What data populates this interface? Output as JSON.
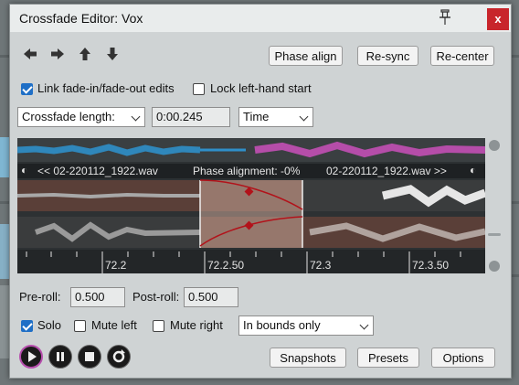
{
  "window": {
    "title": "Crossfade Editor: Vox",
    "close_label": "x"
  },
  "toolbar": {
    "phase_align": "Phase align",
    "resync": "Re-sync",
    "recenter": "Re-center",
    "arrow_icons": [
      "arrow-left-icon",
      "arrow-right-icon",
      "arrow-up-icon",
      "arrow-down-icon"
    ]
  },
  "options": {
    "link_edits": {
      "label": "Link fade-in/fade-out edits",
      "checked": true
    },
    "lock_left": {
      "label": "Lock left-hand start",
      "checked": false
    }
  },
  "crossfade": {
    "length_mode": "Crossfade length:",
    "length_value": "0:00.245",
    "unit": "Time"
  },
  "waveform": {
    "left_item": "<< 02-220112_1922.wav",
    "phase_text": "Phase alignment: -0%",
    "right_item": "02-220112_1922.wav >>",
    "ticks": [
      "72.2",
      "72.2.50",
      "72.3",
      "72.3.50"
    ],
    "colors": {
      "left_track": "#2f8fc9",
      "right_track": "#c34fb5",
      "fade_region": "#c9a597",
      "curve": "#b2121a"
    }
  },
  "roll": {
    "pre_label": "Pre-roll:",
    "pre_value": "0.500",
    "post_label": "Post-roll:",
    "post_value": "0.500"
  },
  "playback": {
    "solo": {
      "label": "Solo",
      "checked": true
    },
    "mute_left": {
      "label": "Mute left",
      "checked": false
    },
    "mute_right": {
      "label": "Mute right",
      "checked": false
    },
    "bounds_mode": "In bounds only"
  },
  "footer": {
    "snapshots": "Snapshots",
    "presets": "Presets",
    "options": "Options"
  },
  "transport_icons": [
    "play-icon",
    "pause-icon",
    "stop-icon",
    "loop-icon"
  ]
}
